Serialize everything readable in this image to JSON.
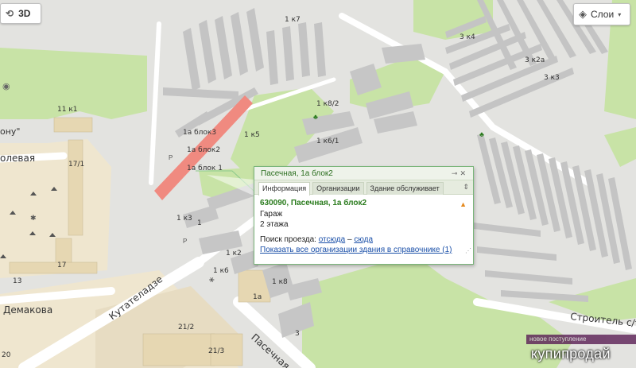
{
  "controls": {
    "btn3d_label": "3D",
    "layers_label": "Слои"
  },
  "map_labels": {
    "k7": "1 к7",
    "k4": "3 к4",
    "k2a": "3 к2а",
    "k3_right": "3 к3",
    "k1_11": "11 к1",
    "k8_2": "1 к8/2",
    "k6_1": "1 к6/1",
    "k5": "1 к5",
    "blok3": "1а блок3",
    "blok2": "1а блок2",
    "blok1": "1а блок 1",
    "onu": "ону\"",
    "olevaya": "олевая",
    "n17_1": "17/1",
    "n17": "17",
    "n13": "13",
    "demakova": "Демакова",
    "k3": "1 к3",
    "n1": "1",
    "k2": "1 к2",
    "k6": "1 к6",
    "k8": "1 к8",
    "n1a": "1а",
    "n3": "3",
    "kutateladze": "Кутателадзе",
    "n21_2": "21/2",
    "n21_3": "21/3",
    "n20": "20",
    "pasechnaya": "Пасечная",
    "stroitel": "Строитель с/т"
  },
  "popup": {
    "title": "Пасечная, 1а блок2",
    "tabs": [
      "Информация",
      "Организации",
      "Здание обслуживает"
    ],
    "address": "630090, Пасечная, 1а блок2",
    "type": "Гараж",
    "floors": "2 этажа",
    "route_prefix": "Поиск проезда:",
    "route_from": "отсюда",
    "route_sep": "–",
    "route_to": "сюда",
    "show_all": "Показать все организации здания в справочнике (1)"
  },
  "watermark": {
    "bar_text": "новое поступление",
    "brand": "купипродай"
  },
  "colors": {
    "highlight": "#f08a80",
    "green_area": "#c8e3a6",
    "building": "#c4c4c4",
    "road": "#ffffff"
  }
}
